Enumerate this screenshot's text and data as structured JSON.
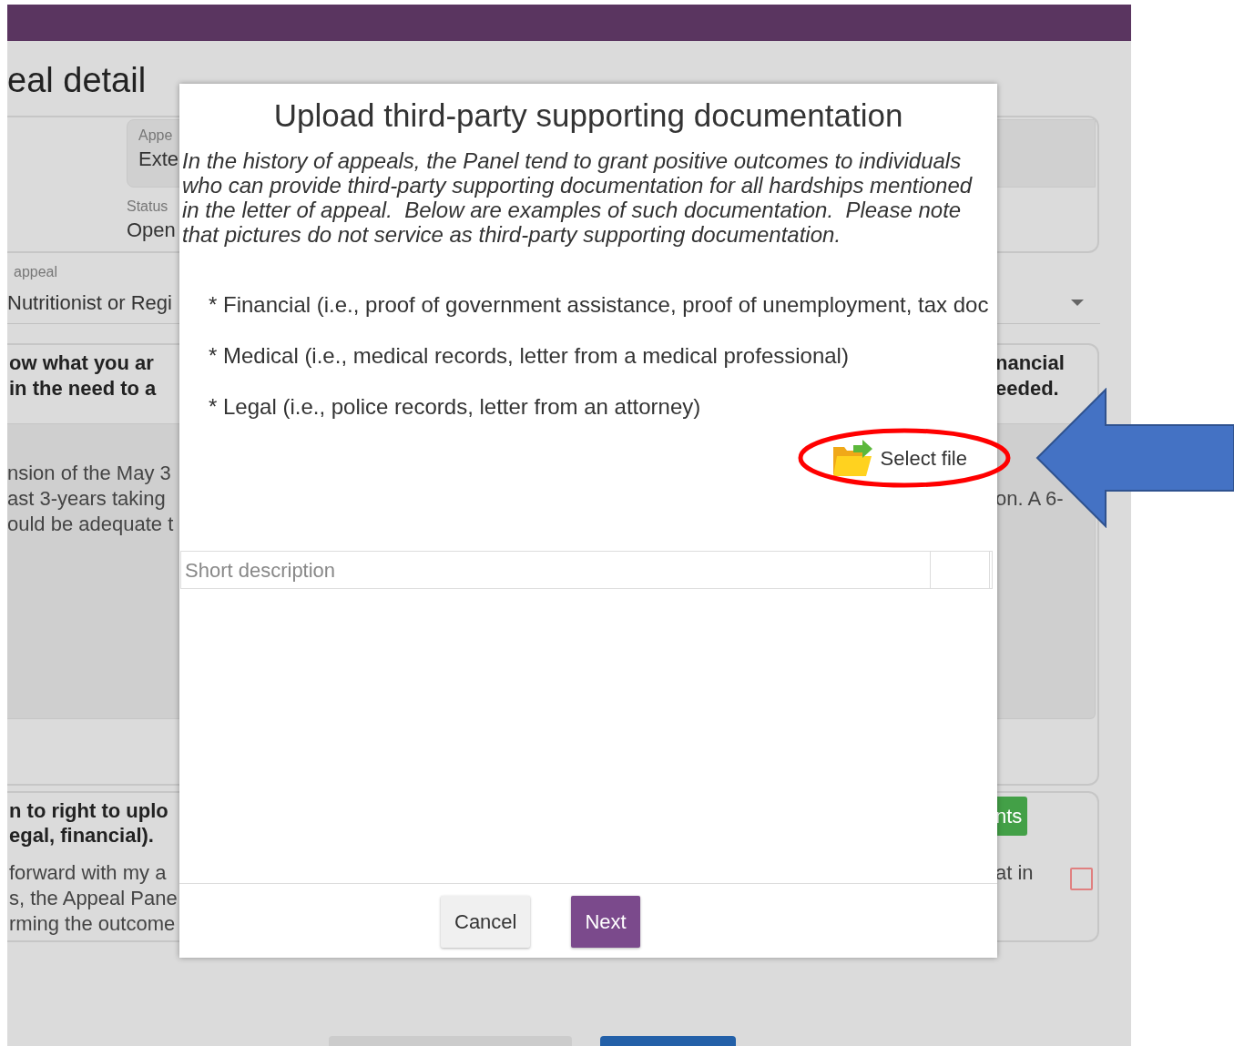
{
  "page_title": "eal detail",
  "summary": {
    "type_label": "Appe",
    "type_value": "Exte",
    "status_label": "Status",
    "status_value": "Open"
  },
  "appeal_select": {
    "label": "appeal",
    "value": "Nutritionist or Regi"
  },
  "statement_card": {
    "prompt": [
      {
        "left": "ow what you ar",
        "right": "nancial"
      },
      {
        "left": "in the need to a",
        "right": "eeded."
      }
    ],
    "answer": [
      {
        "left": "nsion of the May 3"
      },
      {
        "left": "ast 3-years taking",
        "right": "on. A 6-"
      },
      {
        "left": "ould be adequate t"
      }
    ]
  },
  "upload_card": {
    "prompt": [
      {
        "left": "n to right to uplo"
      },
      {
        "left": "egal, financial)."
      }
    ],
    "button": "nts",
    "note": [
      {
        "left": "forward with my a",
        "right": "at in"
      },
      {
        "left": "s, the Appeal Pane"
      },
      {
        "left": "rming the outcome"
      }
    ],
    "checkbox": {
      "checked": false
    }
  },
  "dialog": {
    "title": "Upload third-party supporting documentation",
    "intro": "In the history of appeals, the Panel tend to grant positive outcomes to individuals\nwho can provide third-party supporting documentation for all hardships mentioned\nin the letter of appeal.  Below are examples of such documentation.  Please note\nthat pictures do not service as third-party supporting documentation.",
    "examples": [
      "* Financial (i.e., proof of government assistance, proof of unemployment, tax doc",
      "* Medical (i.e., medical records, letter from a medical professional)",
      "* Legal (i.e., police records, letter from an attorney)"
    ],
    "select_file": "Select file",
    "description_placeholder": "Short description",
    "buttons": [
      {
        "label": "Cancel",
        "kind": "secondary"
      },
      {
        "label": "Next",
        "kind": "primary"
      }
    ]
  }
}
